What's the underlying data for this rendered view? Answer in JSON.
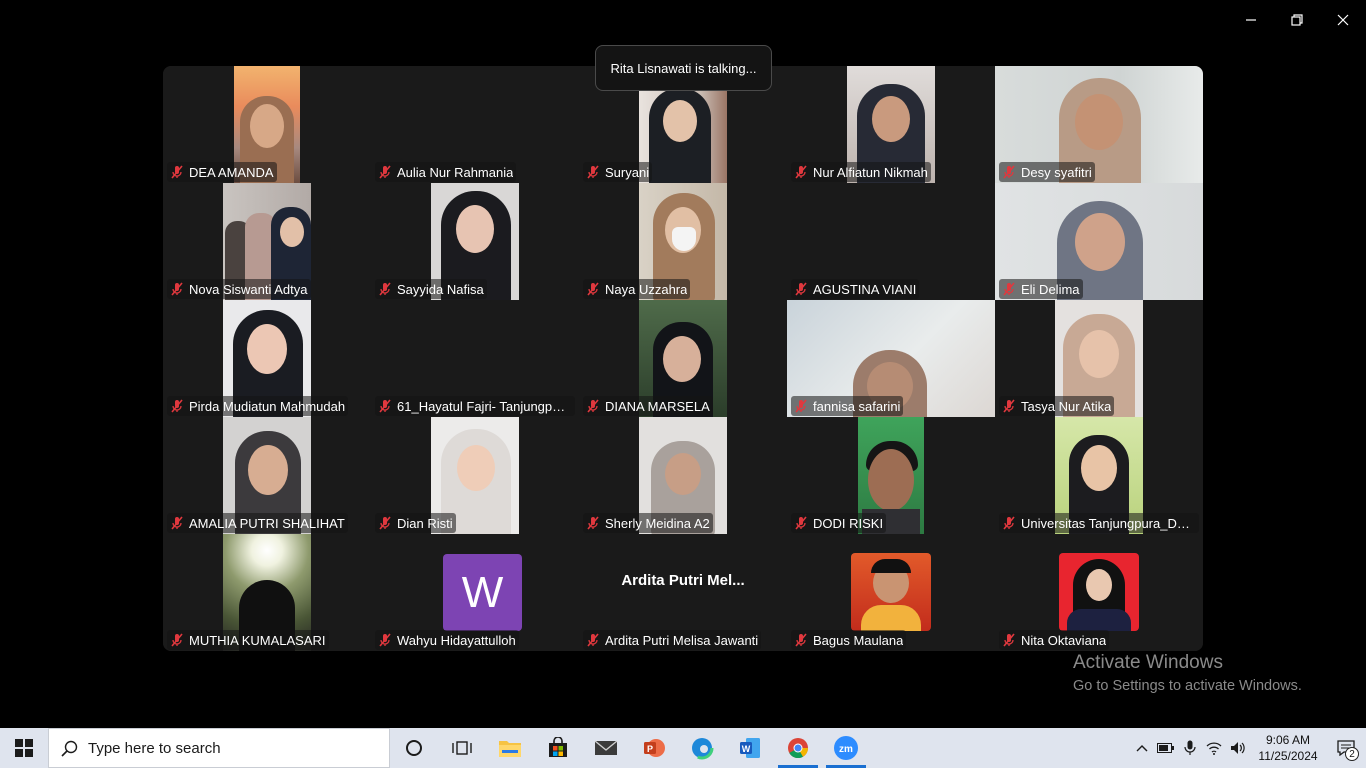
{
  "toast": "Rita Lisnawati is talking...",
  "participants": [
    "DEA AMANDA",
    "Aulia Nur Rahmania",
    "Suryani",
    "Nur Alfiatun Nikmah",
    "Desy syafitri",
    "Nova Siswanti Adtya",
    "Sayyida Nafisa",
    "Naya Uzzahra",
    "AGUSTINA VIANI",
    "Eli Delima",
    "Pirda Mudiatun Mahmudah",
    "61_Hayatul Fajri- Tanjungpura...",
    "DIANA MARSELA",
    "fannisa safarini",
    "Tasya Nur Atika",
    "AMALIA PUTRI SHALIHAT",
    "Dian Risti",
    "Sherly Meidina A2",
    "DODI RISKI",
    "Universitas Tanjungpura_Della...",
    "MUTHIA KUMALASARI",
    "Wahyu Hidayattulloh",
    "Ardita Putri Melisa Jawanti",
    "Bagus Maulana",
    "Nita Oktaviana"
  ],
  "avatar_letter": "W",
  "big_name": "Ardita Putri Mel...",
  "activate": {
    "line1": "Activate Windows",
    "line2": "Go to Settings to activate Windows."
  },
  "taskbar": {
    "search_placeholder": "Type here to search",
    "time": "9:06 AM",
    "date": "11/25/2024",
    "notifications": "2"
  },
  "colors": {
    "accent": "#1a6fd1",
    "avatar": "#7d44b3",
    "mute": "#e0383e"
  }
}
